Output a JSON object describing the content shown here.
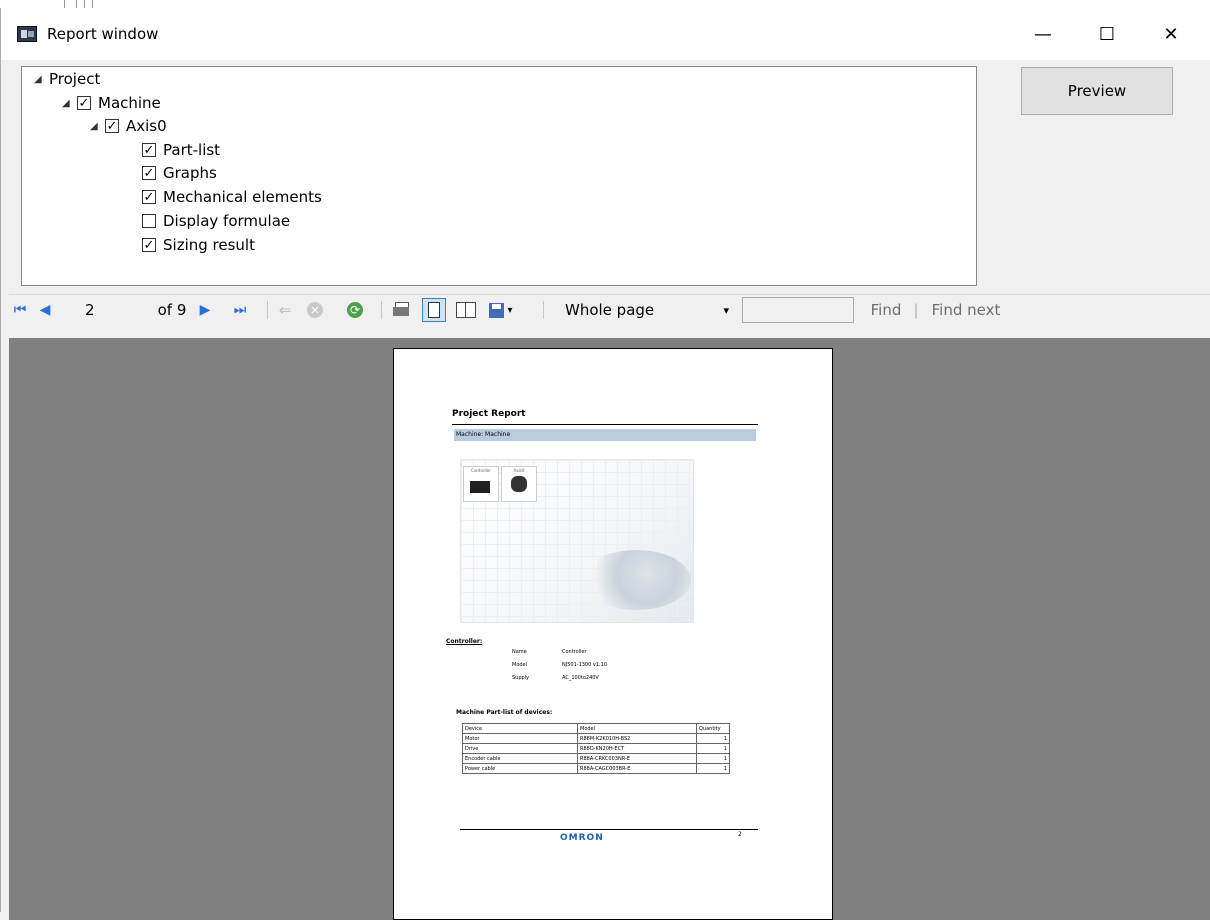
{
  "window": {
    "title": "Report window",
    "minimize": "—",
    "maximize": "☐",
    "close": "✕"
  },
  "tree": {
    "project": "Project",
    "machine": "Machine",
    "axis": "Axis0",
    "items": [
      {
        "label": "Part-list",
        "checked": true
      },
      {
        "label": "Graphs",
        "checked": true
      },
      {
        "label": "Mechanical elements",
        "checked": true
      },
      {
        "label": "Display formulae",
        "checked": false
      },
      {
        "label": "Sizing result",
        "checked": true
      }
    ],
    "checkmark": "✓"
  },
  "preview_label": "Preview",
  "toolbar": {
    "first_icon": "⏮",
    "prev_icon": "◀",
    "page_value": "2",
    "of_label": "of 9",
    "next_icon": "▶",
    "last_icon": "⏭",
    "back_icon": "⇐",
    "stop_icon": "✕",
    "refresh_icon": "⟳",
    "save_caret": "▾",
    "zoom_value": "Whole page",
    "zoom_caret": "▾",
    "find_label": "Find",
    "find_sep": "|",
    "find_next_label": "Find next"
  },
  "report": {
    "title": "Project Report",
    "machine_bar": "Machine: Machine",
    "controller_heading": "Controller:",
    "fields": [
      {
        "name": "Name",
        "value": "Controller"
      },
      {
        "name": "Model",
        "value": "NJ501-1300 v1.10"
      },
      {
        "name": "Supply",
        "value": "AC_100to240V"
      }
    ],
    "partlist_title": "Machine Part-list of devices:",
    "table_headers": [
      "Device",
      "Model",
      "Quantity"
    ],
    "table_rows": [
      [
        "Motor",
        "R88M-K2K010H-BS2",
        "1"
      ],
      [
        "Drive",
        "R88D-KN20H-ECT",
        "1"
      ],
      [
        "Encoder cable",
        "R88A-CRKC003NR-E",
        "1"
      ],
      [
        "Power cable",
        "R88A-CAGC003BR-E",
        "1"
      ]
    ],
    "device_labels": [
      "Controller",
      "Axis0"
    ],
    "footer_logo": "OMRON",
    "page_number": "2"
  }
}
